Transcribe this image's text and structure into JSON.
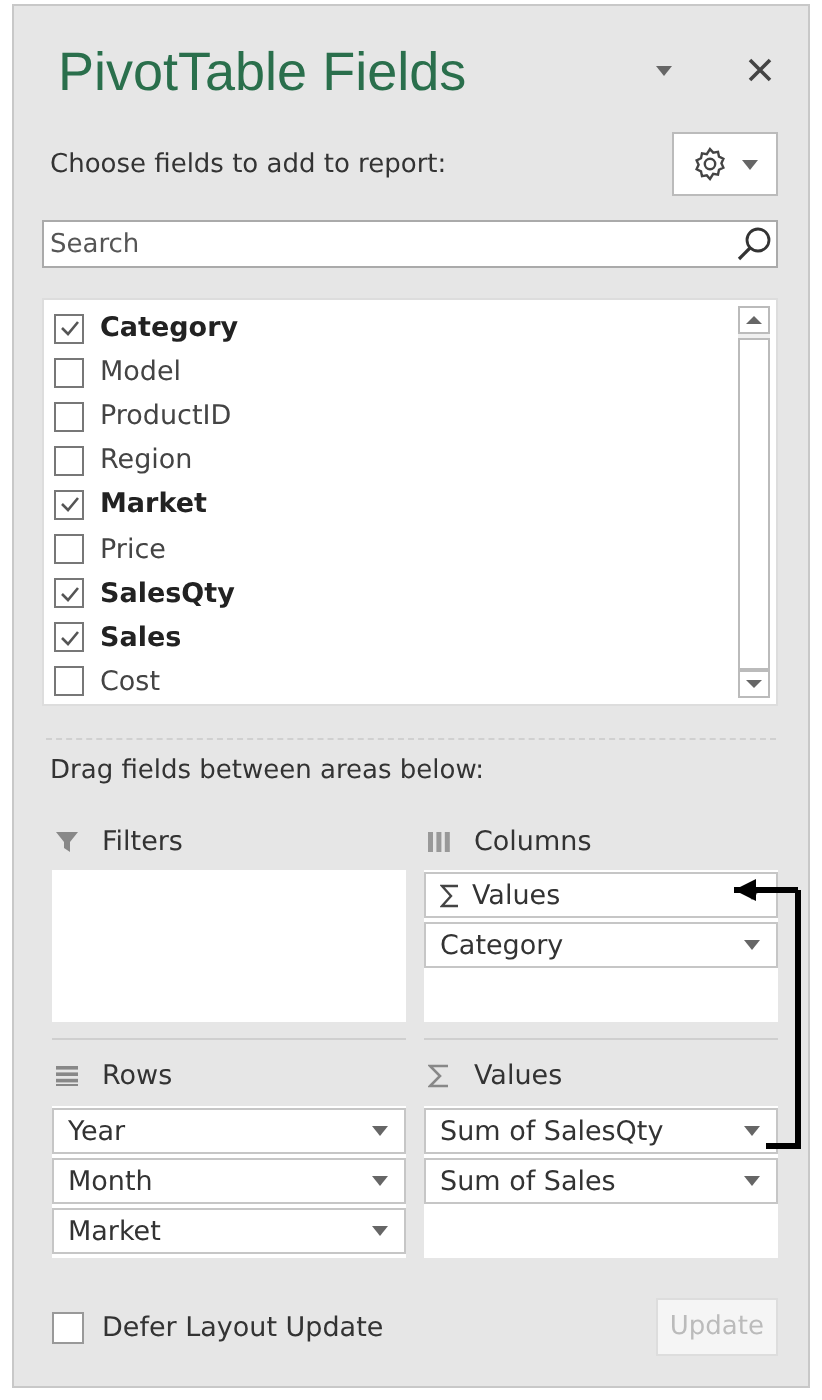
{
  "pane": {
    "title": "PivotTable Fields",
    "prompt": "Choose fields to add to report:"
  },
  "search": {
    "placeholder": "Search"
  },
  "fields": [
    {
      "label": "Category",
      "checked": true
    },
    {
      "label": "Model",
      "checked": false
    },
    {
      "label": "ProductID",
      "checked": false
    },
    {
      "label": "Region",
      "checked": false
    },
    {
      "label": "Market",
      "checked": true
    },
    {
      "label": "Price",
      "checked": false
    },
    {
      "label": "SalesQty",
      "checked": true
    },
    {
      "label": "Sales",
      "checked": true
    },
    {
      "label": "Cost",
      "checked": false
    }
  ],
  "areas_hint": "Drag fields between areas below:",
  "areas": [
    {
      "title": "Filters"
    },
    {
      "title": "Columns",
      "items": [
        {
          "label": "Values",
          "kind": "values"
        },
        {
          "label": "Category",
          "kind": "field"
        }
      ]
    },
    {
      "title": "Rows",
      "items": [
        {
          "label": "Year",
          "kind": "field"
        },
        {
          "label": "Month",
          "kind": "field"
        },
        {
          "label": "Market",
          "kind": "field"
        }
      ]
    },
    {
      "title": "Values",
      "items": [
        {
          "label": "Sum of SalesQty",
          "kind": "field"
        },
        {
          "label": "Sum of Sales",
          "kind": "field"
        }
      ]
    }
  ],
  "defer": {
    "label": "Defer Layout Update",
    "checked": false
  },
  "update_button": {
    "label": "Update",
    "disabled": true
  }
}
